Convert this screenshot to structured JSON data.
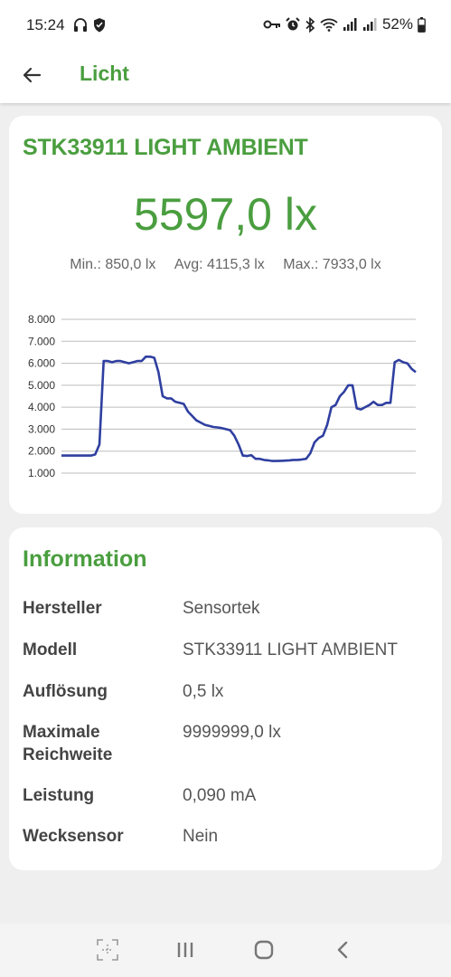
{
  "status": {
    "time": "15:24",
    "battery": "52%"
  },
  "appbar": {
    "title": "Licht"
  },
  "sensor": {
    "name": "STK33911 LIGHT AMBIENT",
    "current": "5597,0 lx",
    "min_label": "Min.: 850,0 lx",
    "avg_label": "Avg: 4115,3 lx",
    "max_label": "Max.: 7933,0 lx"
  },
  "chart_data": {
    "type": "line",
    "title": "",
    "xlabel": "",
    "ylabel": "",
    "ylim": [
      1000,
      8000
    ],
    "yticks": [
      "1.000",
      "2.000",
      "3.000",
      "4.000",
      "5.000",
      "6.000",
      "7.000",
      "8.000"
    ],
    "grid": true,
    "color": "#2f3fa0",
    "series": [
      {
        "values": [
          1800,
          1800,
          1800,
          1800,
          1800,
          1800,
          1800,
          1800,
          1850,
          2300,
          6100,
          6100,
          6050,
          6100,
          6100,
          6050,
          6000,
          6050,
          6100,
          6100,
          6300,
          6300,
          6250,
          5600,
          4500,
          4400,
          4400,
          4250,
          4200,
          4150,
          3800,
          3600,
          3400,
          3300,
          3200,
          3150,
          3100,
          3080,
          3050,
          3000,
          2950,
          2700,
          2300,
          1800,
          1780,
          1820,
          1650,
          1650,
          1600,
          1580,
          1550,
          1550,
          1560,
          1570,
          1580,
          1600,
          1600,
          1620,
          1650,
          1900,
          2400,
          2600,
          2700,
          3200,
          4000,
          4100,
          4500,
          4700,
          5000,
          5000,
          3950,
          3900,
          4000,
          4100,
          4250,
          4100,
          4100,
          4200,
          4200,
          6050,
          6150,
          6050,
          6000,
          5750,
          5597
        ]
      }
    ]
  },
  "info": {
    "title": "Information",
    "rows": [
      {
        "label": "Hersteller",
        "value": "Sensortek"
      },
      {
        "label": "Modell",
        "value": "STK33911 LIGHT AMBIENT"
      },
      {
        "label": "Auflösung",
        "value": "0,5 lx"
      },
      {
        "label": "Maximale Reichweite",
        "value": "9999999,0 lx"
      },
      {
        "label": "Leistung",
        "value": "0,090 mA"
      },
      {
        "label": "Wecksensor",
        "value": "Nein"
      }
    ]
  }
}
